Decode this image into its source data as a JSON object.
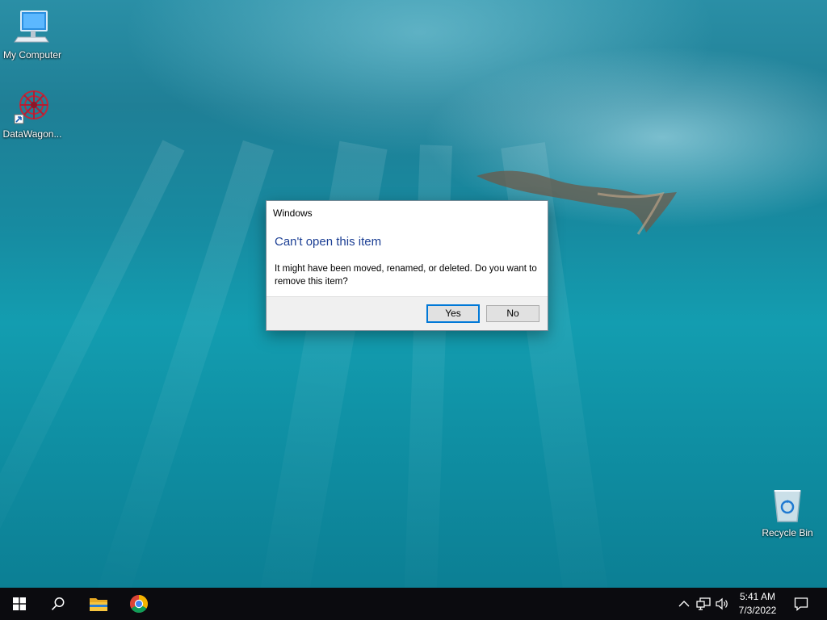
{
  "desktop": {
    "icons": [
      {
        "label": "My Computer",
        "icon": "computer-icon"
      },
      {
        "label": "DataWagon...",
        "icon": "datawagon-icon"
      },
      {
        "label": "Recycle Bin",
        "icon": "recycle-bin-icon"
      }
    ]
  },
  "dialog": {
    "title": "Windows",
    "heading": "Can't open this item",
    "message": "It might have been moved, renamed, or deleted. Do you want to remove this item?",
    "yes_label": "Yes",
    "no_label": "No",
    "accent_color": "#0078d7",
    "heading_color": "#1c3f94"
  },
  "taskbar": {
    "items": [
      {
        "icon": "windows-start-icon"
      },
      {
        "icon": "search-icon"
      },
      {
        "icon": "file-explorer-icon"
      },
      {
        "icon": "chrome-icon"
      }
    ],
    "tray": {
      "icons": [
        "chevron-up-icon",
        "network-icon",
        "volume-icon"
      ],
      "time": "5:41 AM",
      "date": "7/3/2022",
      "notification_icon": "action-center-icon"
    }
  }
}
